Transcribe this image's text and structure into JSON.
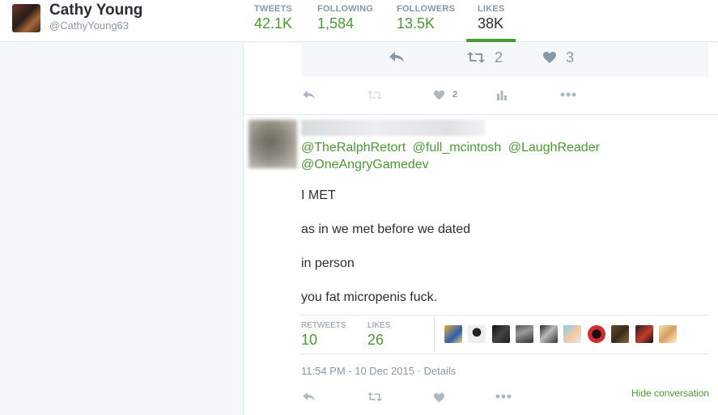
{
  "profile": {
    "name": "Cathy Young",
    "handle": "@CathyYoung63"
  },
  "nav_stats": [
    {
      "label": "TWEETS",
      "value": "42.1K"
    },
    {
      "label": "FOLLOWING",
      "value": "1,584"
    },
    {
      "label": "FOLLOWERS",
      "value": "13.5K"
    },
    {
      "label": "LIKES",
      "value": "38K"
    }
  ],
  "quoted_tweet_actions": {
    "reply_icon": "reply-icon",
    "retweet_icon": "retweet-icon",
    "retweet_count": "2",
    "like_icon": "heart-icon",
    "like_count": "3"
  },
  "previous_tweet_actions": {
    "like_count": "2"
  },
  "tweet": {
    "mentions": [
      "@TheRalphRetort",
      "@full_mcintosh",
      "@LaughReader",
      "@OneAngryGamedev"
    ],
    "lines": [
      "I MET",
      "as in we met before we dated",
      "in person",
      "you fat micropenis fuck."
    ],
    "retweets_label": "RETWEETS",
    "retweets_value": "10",
    "likes_label": "LIKES",
    "likes_value": "26",
    "timestamp": "11:54 PM - 10 Dec 2015 · Details",
    "hide_conversation": "Hide conversation"
  },
  "colors": {
    "accent_green": "#4a9a34",
    "muted": "#8899a6",
    "border": "#e1e8ed"
  }
}
